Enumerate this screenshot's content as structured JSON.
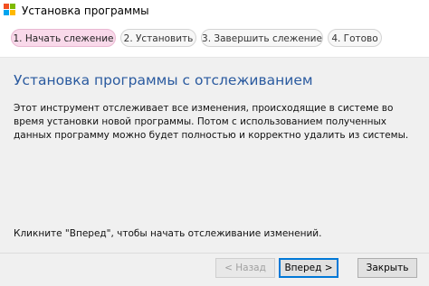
{
  "window": {
    "title": "Установка программы",
    "icon": "windows-logo-icon",
    "icon_colors": [
      "#f25022",
      "#7fba00",
      "#00a4ef",
      "#ffb900"
    ]
  },
  "steps": [
    {
      "label": "1. Начать слежение",
      "active": true
    },
    {
      "label": "2. Установить",
      "active": false
    },
    {
      "label": "3. Завершить слежение",
      "active": false
    },
    {
      "label": "4. Готово",
      "active": false
    }
  ],
  "main": {
    "heading": "Установка программы с отслеживанием",
    "description": "Этот инструмент отслеживает все изменения, происходящие в системе во время установки новой программы. Потом с использованием полученных данных программу можно будет полностью и корректно удалить из системы.",
    "hint": "Кликните \"Вперед\", чтобы начать отслеживание изменений."
  },
  "footer": {
    "back_label": "< Назад",
    "next_label": "Вперед >",
    "close_label": "Закрыть"
  },
  "colors": {
    "accent": "#2a5a9f",
    "active_step": "#f9d9ea",
    "focus_border": "#0078d7"
  }
}
